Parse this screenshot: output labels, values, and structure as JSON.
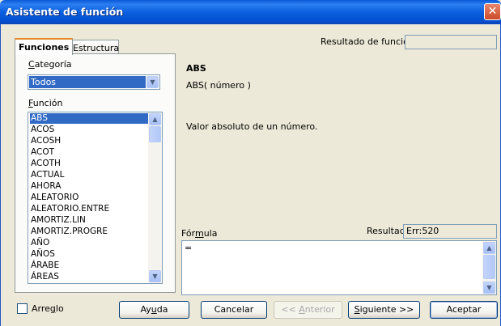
{
  "window": {
    "title": "Asistente de función",
    "close_glyph": "✕"
  },
  "tabs": [
    {
      "label": "Funciones",
      "active": true
    },
    {
      "label": "Estructura",
      "active": false
    }
  ],
  "top_right": {
    "result_label": "Resultado de función",
    "result_value": ""
  },
  "left": {
    "category_label": "Categoría",
    "category_value": "Todos",
    "function_label": "Función",
    "functions": [
      "ABS",
      "ACOS",
      "ACOSH",
      "ACOT",
      "ACOTH",
      "ACTUAL",
      "AHORA",
      "ALEATORIO",
      "ALEATORIO.ENTRE",
      "AMORTIZ.LIN",
      "AMORTIZ.PROGRE",
      "AÑO",
      "AÑOS",
      "ÁRABE",
      "ÁREAS"
    ],
    "selected_index": 0
  },
  "info": {
    "name": "ABS",
    "syntax": "ABS( número )",
    "description": "Valor absoluto de un número."
  },
  "formula": {
    "label": "Fórmula",
    "result_label": "Resultado",
    "result_value": "Err:520",
    "text": "="
  },
  "footer": {
    "array_label": "Arreglo",
    "array_checked": false,
    "help_button": "Ayuda",
    "cancel_button": "Cancelar",
    "back_button": "<< Anterior",
    "next_button": "Siguiente >>",
    "ok_button": "Aceptar"
  },
  "icons": {
    "dropdown": "chevron-down-icon",
    "scroll_up": "scroll-up-icon",
    "scroll_down": "scroll-down-icon",
    "close": "close-icon"
  },
  "colors": {
    "titlebar": "#0b5fe0",
    "selection": "#316ac5",
    "dialog_bg": "#ece9d8",
    "close": "#cc4a2a"
  }
}
